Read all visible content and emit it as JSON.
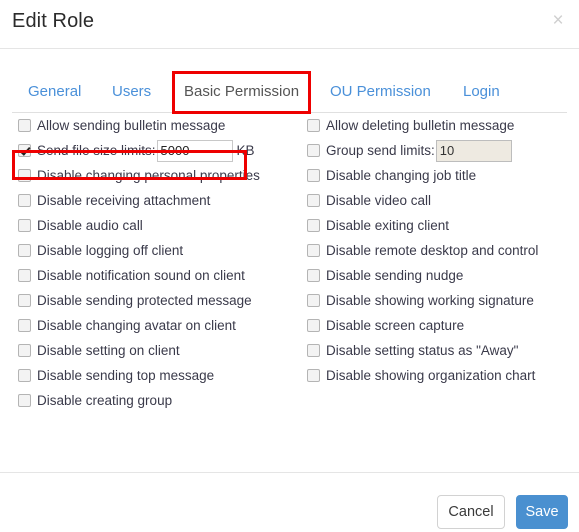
{
  "dialog": {
    "title": "Edit Role",
    "close_icon": "close-icon",
    "close_label": "×"
  },
  "tabs": [
    {
      "label": "General",
      "active": false
    },
    {
      "label": "Users",
      "active": false
    },
    {
      "label": "Basic Permission",
      "active": true
    },
    {
      "label": "OU Permission",
      "active": false
    },
    {
      "label": "Login",
      "active": false
    }
  ],
  "highlights": [
    {
      "name": "tab-highlight",
      "target": "Basic Permission",
      "color": "#ee0000"
    },
    {
      "name": "file-size-highlight",
      "target": "Send file size limits",
      "color": "#ee0000"
    }
  ],
  "permissions": {
    "left_column": [
      {
        "label": "Allow sending bulletin message",
        "checked": false
      },
      {
        "label": "Send file size limits:",
        "checked": true,
        "input": {
          "value": "5000",
          "unit": "KB",
          "disabled": false
        }
      },
      {
        "label": "Disable changing personal properties",
        "checked": false
      },
      {
        "label": "Disable receiving attachment",
        "checked": false
      },
      {
        "label": "Disable audio call",
        "checked": false
      },
      {
        "label": "Disable logging off client",
        "checked": false
      },
      {
        "label": "Disable notification sound on client",
        "checked": false
      },
      {
        "label": "Disable sending protected message",
        "checked": false
      },
      {
        "label": "Disable changing avatar on client",
        "checked": false
      },
      {
        "label": "Disable setting on client",
        "checked": false
      },
      {
        "label": "Disable sending top message",
        "checked": false
      },
      {
        "label": "Disable creating group",
        "checked": false
      }
    ],
    "right_column": [
      {
        "label": "Allow deleting bulletin message",
        "checked": false
      },
      {
        "label": "Group send limits:",
        "checked": false,
        "input": {
          "value": "10",
          "unit": "",
          "disabled": true
        }
      },
      {
        "label": "Disable changing job title",
        "checked": false
      },
      {
        "label": "Disable video call",
        "checked": false
      },
      {
        "label": "Disable exiting client",
        "checked": false
      },
      {
        "label": "Disable remote desktop and control",
        "checked": false
      },
      {
        "label": "Disable sending nudge",
        "checked": false
      },
      {
        "label": "Disable showing working signature",
        "checked": false
      },
      {
        "label": "Disable screen capture",
        "checked": false
      },
      {
        "label": "Disable setting status as \"Away\"",
        "checked": false
      },
      {
        "label": "Disable showing organization chart",
        "checked": false
      }
    ]
  },
  "footer": {
    "cancel_label": "Cancel",
    "save_label": "Save"
  },
  "colors": {
    "accent": "#4a90d0",
    "tab_link": "#4a90d9",
    "highlight": "#ee0000",
    "text": "#3a3a4a",
    "disabled_field": "#eeeae1"
  }
}
